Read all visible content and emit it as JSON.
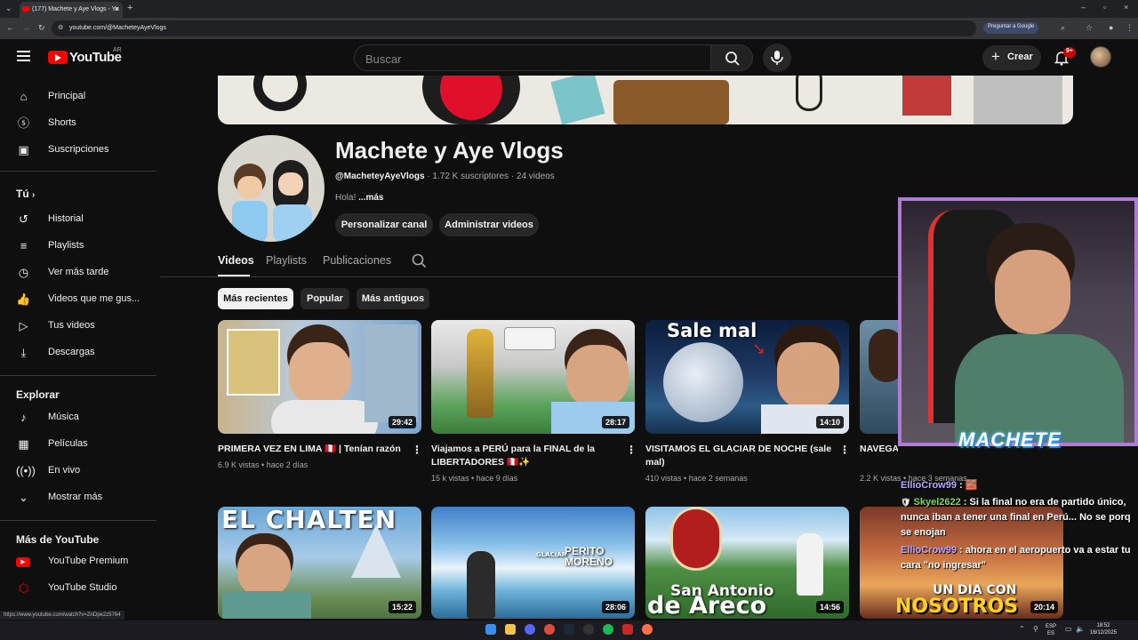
{
  "browser": {
    "tab_title": "(177) Machete y Aye Vlogs - Yo",
    "url": "youtube.com/@MacheteyAyeVlogs",
    "google_pill": "Preguntar a Google",
    "status_url": "https://www.youtube.com/watch?v=ZnDpe2z5764"
  },
  "header": {
    "logo_text": "YouTube",
    "region": "AR",
    "search_placeholder": "Buscar",
    "create_label": "Crear",
    "notif_count": "9+"
  },
  "sidebar": {
    "main": [
      {
        "label": "Principal",
        "icon": "home-icon"
      },
      {
        "label": "Shorts",
        "icon": "shorts-icon"
      },
      {
        "label": "Suscripciones",
        "icon": "subscriptions-icon"
      }
    ],
    "you_heading": "Tú",
    "you": [
      {
        "label": "Historial",
        "icon": "history-icon"
      },
      {
        "label": "Playlists",
        "icon": "playlists-icon"
      },
      {
        "label": "Ver más tarde",
        "icon": "watch-later-icon"
      },
      {
        "label": "Videos que me gus...",
        "icon": "liked-icon"
      },
      {
        "label": "Tus videos",
        "icon": "your-videos-icon"
      },
      {
        "label": "Descargas",
        "icon": "downloads-icon"
      }
    ],
    "explore_heading": "Explorar",
    "explore": [
      {
        "label": "Música",
        "icon": "music-icon"
      },
      {
        "label": "Películas",
        "icon": "movies-icon"
      },
      {
        "label": "En vivo",
        "icon": "live-icon"
      },
      {
        "label": "Mostrar más",
        "icon": "chevron-down-icon"
      }
    ],
    "more_heading": "Más de YouTube",
    "more": [
      {
        "label": "YouTube Premium",
        "icon": "yt-premium-icon"
      },
      {
        "label": "YouTube Studio",
        "icon": "yt-studio-icon"
      }
    ]
  },
  "channel": {
    "name": "Machete y Aye Vlogs",
    "handle": "@MacheteyAyeVlogs",
    "subs": " · 1.72 K suscriptores · 24 videos",
    "desc": "Hola! ",
    "desc_more": "...más",
    "btn_customize": "Personalizar canal",
    "btn_manage": "Administrar videos",
    "tabs": [
      "Videos",
      "Playlists",
      "Publicaciones"
    ],
    "chips": [
      "Más recientes",
      "Popular",
      "Más antiguos"
    ]
  },
  "videos": [
    {
      "title": "PRIMERA VEZ EN LIMA 🇵🇪 | Tenían razón",
      "views": "6.9 K vistas",
      "age": "hace 2 días",
      "duration": "29:42"
    },
    {
      "title": "Viajamos a PERÚ para la FINAL de la LIBERTADORES 🇵🇪✨",
      "views": "15 k vistas",
      "age": "hace 9 días",
      "duration": "28:17"
    },
    {
      "title": "VISITAMOS EL GLACIAR DE NOCHE (sale mal)",
      "views": "410 vistas",
      "age": "hace 2 semanas",
      "duration": "14:10",
      "overlay": "Sale mal"
    },
    {
      "title": "NAVEGA... GRANDES...",
      "views": "2.2 K vistas",
      "age": "hace 3 semanas",
      "duration": ""
    },
    {
      "duration": "15:22",
      "overlay": "EL CHALTEN"
    },
    {
      "duration": "28:06",
      "overlay": "PERITO MORENO",
      "overlay_small": "GLACIAR"
    },
    {
      "duration": "14:56",
      "overlay": "San Antonio",
      "overlay2": "de Areco"
    },
    {
      "duration": "20:14",
      "overlay": "UN DIA CON",
      "overlay2": "NOSOTROS"
    }
  ],
  "stream": {
    "cam_label": "MACHETE",
    "chat": [
      {
        "user": "EllioCrow99",
        "msg": " : 🧱"
      },
      {
        "user": "Skyel2622",
        "msg": " : Si la final no era de partido único, nunca iban a tener una final en Perú... No se porq se enojan"
      },
      {
        "user": "EllioCrow99",
        "msg": " : ahora en el aeropuerto va a estar tu cara \"no ingresar\""
      }
    ]
  },
  "taskbar": {
    "lang": "ESP",
    "lang2": "ES",
    "time": "18:52",
    "date": "16/12/2025"
  }
}
